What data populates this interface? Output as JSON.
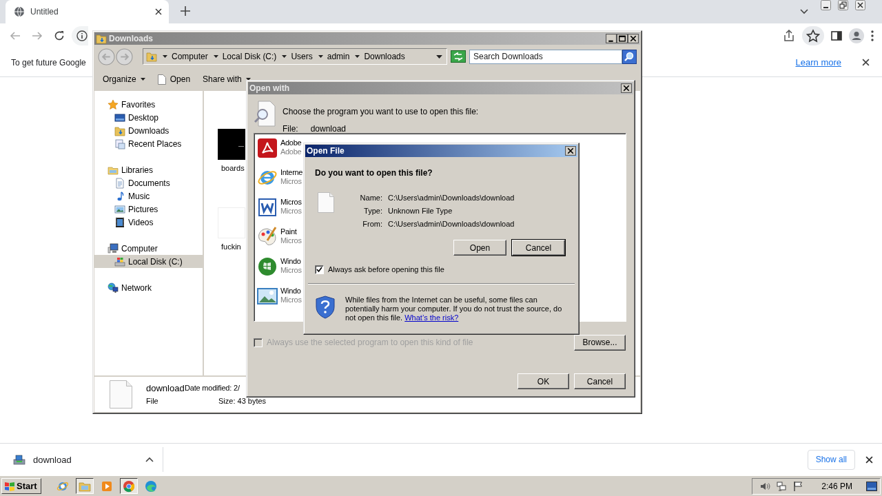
{
  "browser": {
    "tabs": [
      {
        "title": "Untitled",
        "selected": true
      }
    ],
    "infobar": {
      "message": "To get future Google",
      "link": "Learn more"
    }
  },
  "explorer": {
    "title": "Downloads",
    "breadcrumb": [
      "Computer",
      "Local Disk (C:)",
      "Users",
      "admin",
      "Downloads"
    ],
    "search": {
      "placeholder": "Search Downloads"
    },
    "toolbar": [
      {
        "label": "Organize",
        "kind": "menu"
      },
      {
        "label": "Open",
        "kind": "file"
      },
      {
        "label": "Share with",
        "kind": "menu"
      }
    ],
    "nav": [
      {
        "label": "Favorites",
        "selected": false,
        "children": [
          {
            "label": "Desktop",
            "selected": false
          },
          {
            "label": "Downloads",
            "selected": false
          },
          {
            "label": "Recent Places",
            "selected": false
          }
        ]
      },
      {
        "label": "Libraries",
        "selected": false,
        "children": [
          {
            "label": "Documents",
            "selected": false
          },
          {
            "label": "Music",
            "selected": false
          },
          {
            "label": "Pictures",
            "selected": false
          },
          {
            "label": "Videos",
            "selected": false
          }
        ]
      },
      {
        "label": "Computer",
        "selected": false,
        "children": [
          {
            "label": "Local Disk (C:)",
            "selected": true
          }
        ]
      },
      {
        "label": "Network",
        "selected": false
      }
    ],
    "files": [
      {
        "name": "boards",
        "kind": "dark"
      },
      {
        "name": "fuckin",
        "kind": "blank"
      }
    ],
    "details": {
      "name": "download",
      "date_modified": "Date modified: 2/",
      "type": "File",
      "size": "Size: 43 bytes"
    }
  },
  "open_with": {
    "title": "Open with",
    "prompt": "Choose the program you want to use to open this file:",
    "file_label": "File:",
    "file_name": "download",
    "programs": [
      {
        "name": "Adobe",
        "publisher": "Adobe"
      },
      {
        "name": "Interne",
        "publisher": "Micros"
      },
      {
        "name": "Micros",
        "publisher": "Micros"
      },
      {
        "name": "Paint",
        "publisher": "Micros"
      },
      {
        "name": "Windo",
        "publisher": "Micros"
      },
      {
        "name": "Windo",
        "publisher": "Micros"
      }
    ],
    "always_use": {
      "label": "Always use the selected program to open this kind of file",
      "checked": false,
      "disabled": true
    },
    "browse": "Browse...",
    "ok": "OK",
    "cancel": "Cancel"
  },
  "open_file": {
    "title": "Open File",
    "question": "Do you want to open this file?",
    "fields": [
      {
        "label": "Name:",
        "value": "C:\\Users\\admin\\Downloads\\download"
      },
      {
        "label": "Type:",
        "value": "Unknown File Type"
      },
      {
        "label": "From:",
        "value": "C:\\Users\\admin\\Downloads\\download"
      }
    ],
    "buttons": [
      {
        "label": "Open",
        "default": false
      },
      {
        "label": "Cancel",
        "default": true
      }
    ],
    "always_ask": {
      "label": "Always ask before opening this file",
      "checked": true
    },
    "warning": "While files from the Internet can be useful, some files can potentially harm your computer. If you do not trust the source, do not open this file.",
    "risk_link": "What’s the risk?"
  },
  "download_bar": {
    "items": [
      {
        "name": "download"
      }
    ],
    "show_all": "Show all"
  },
  "taskbar": {
    "start": "Start",
    "clock": "2:46 PM",
    "apps": [
      {
        "kind": "ie",
        "pressed": false
      },
      {
        "kind": "explorer",
        "pressed": true
      },
      {
        "kind": "media",
        "pressed": false
      },
      {
        "kind": "chrome",
        "pressed": true
      },
      {
        "kind": "edge",
        "pressed": false
      }
    ]
  }
}
